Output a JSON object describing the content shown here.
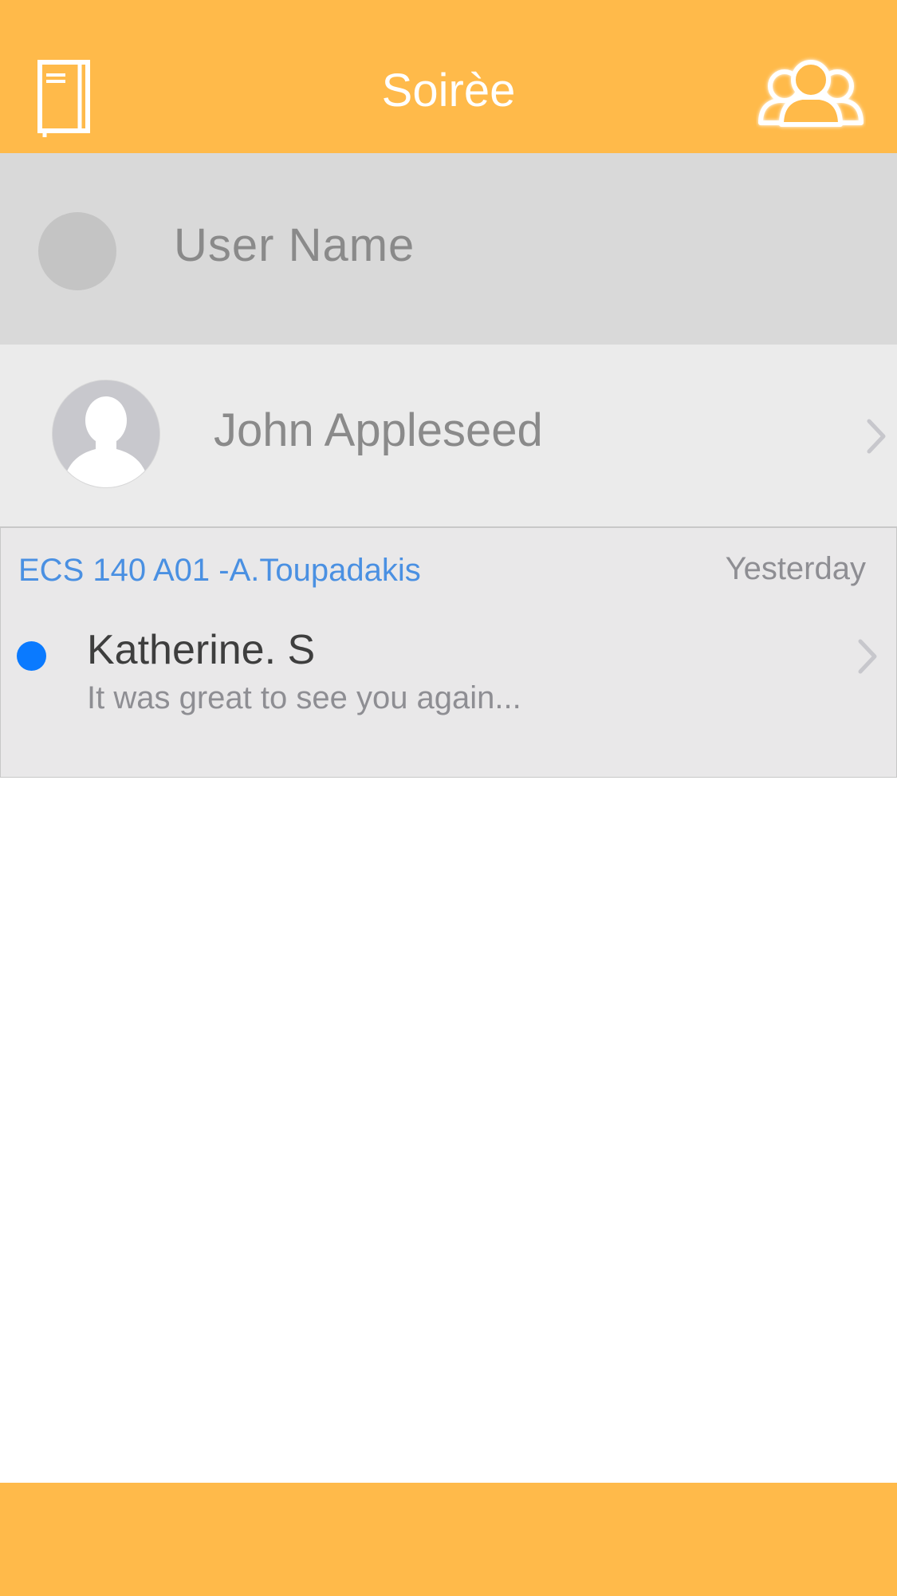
{
  "header": {
    "title": "Soirèe",
    "left_icon": "notebook-icon",
    "right_icon": "friends-group-icon",
    "background_color": "#FFBA4A"
  },
  "user": {
    "name_placeholder": "User Name",
    "avatar_icon": "avatar-placeholder-icon"
  },
  "contact": {
    "name": "John Appleseed",
    "avatar_icon": "person-silhouette-icon",
    "chevron_icon": "chevron-right-icon"
  },
  "message": {
    "course": "ECS 140 A01 -A.Toupadakis",
    "time": "Yesterday",
    "sender": "Katherine. S",
    "preview": "It was great to see you again...",
    "unread": true,
    "unread_color": "#0A7AFF",
    "course_color": "#4A90E2"
  },
  "bottom_bar": {
    "background_color": "#FFBA4A"
  }
}
